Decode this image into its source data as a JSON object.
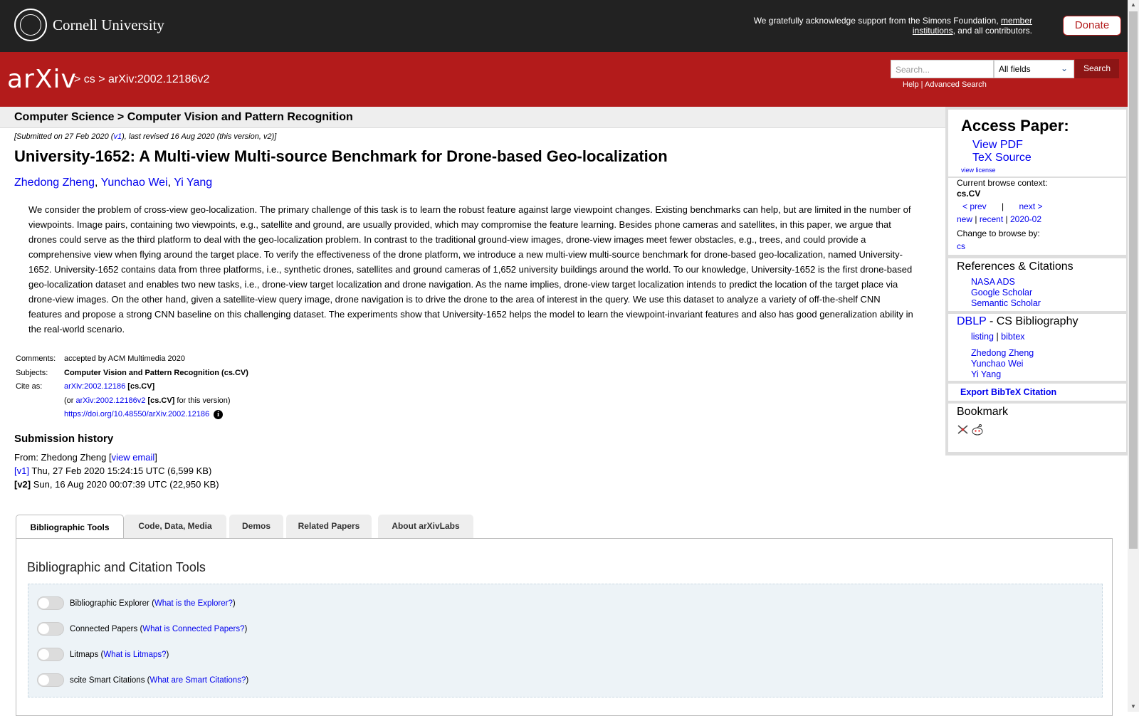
{
  "topbar": {
    "university": "Cornell University",
    "support_prefix": "We gratefully acknowledge support from the Simons Foundation, ",
    "support_link": "member institutions",
    "support_suffix": ", and all contributors.",
    "donate_label": "Donate"
  },
  "header": {
    "logo_text": "arXiv",
    "crumb_sep1": "> ",
    "crumb_cs": "cs",
    "crumb_sep2": " > ",
    "crumb_id": "arXiv:2002.12186v2",
    "search_placeholder": "Search...",
    "field_select": "All fields",
    "search_button": "Search",
    "help": "Help",
    "help_sep": " | ",
    "advanced": "Advanced Search"
  },
  "subject_bar": "Computer Science > Computer Vision and Pattern Recognition",
  "dateline": {
    "prefix": "[Submitted on 27 Feb 2020 (",
    "v1": "v1",
    "suffix": "), last revised 16 Aug 2020 (this version, v2)]"
  },
  "title": "University-1652: A Multi-view Multi-source Benchmark for Drone-based Geo-localization",
  "authors": [
    "Zhedong Zheng",
    "Yunchao Wei",
    "Yi Yang"
  ],
  "abstract": "We consider the problem of cross-view geo-localization. The primary challenge of this task is to learn the robust feature against large viewpoint changes. Existing benchmarks can help, but are limited in the number of viewpoints. Image pairs, containing two viewpoints, e.g., satellite and ground, are usually provided, which may compromise the feature learning. Besides phone cameras and satellites, in this paper, we argue that drones could serve as the third platform to deal with the geo-localization problem. In contrast to the traditional ground-view images, drone-view images meet fewer obstacles, e.g., trees, and could provide a comprehensive view when flying around the target place. To verify the effectiveness of the drone platform, we introduce a new multi-view multi-source benchmark for drone-based geo-localization, named University-1652. University-1652 contains data from three platforms, i.e., synthetic drones, satellites and ground cameras of 1,652 university buildings around the world. To our knowledge, University-1652 is the first drone-based geo-localization dataset and enables two new tasks, i.e., drone-view target localization and drone navigation. As the name implies, drone-view target localization intends to predict the location of the target place via drone-view images. On the other hand, given a satellite-view query image, drone navigation is to drive the drone to the area of interest in the query. We use this dataset to analyze a variety of off-the-shelf CNN features and propose a strong CNN baseline on this challenging dataset. The experiments show that University-1652 helps the model to learn the viewpoint-invariant features and also has good generalization ability in the real-world scenario.",
  "meta": {
    "comments_label": "Comments:",
    "comments": "accepted by ACM Multimedia 2020",
    "subjects_label": "Subjects:",
    "subjects": "Computer Vision and Pattern Recognition (cs.CV)",
    "cite_label": "Cite as:",
    "cite_id": "arXiv:2002.12186",
    "cite_cat": " [cs.CV]",
    "cite2_prefix": "(or ",
    "cite2_id": "arXiv:2002.12186v2",
    "cite2_cat": " [cs.CV]",
    "cite2_suffix": " for this version)",
    "doi": "https://doi.org/10.48550/arXiv.2002.12186",
    "info_glyph": "i"
  },
  "history": {
    "heading": "Submission history",
    "from_prefix": "From: Zhedong Zheng [",
    "view_email": "view email",
    "from_suffix": "]",
    "v1_label": "[v1]",
    "v1_text": " Thu, 27 Feb 2020 15:24:15 UTC (6,599 KB)",
    "v2_label": "[v2]",
    "v2_text": " Sun, 16 Aug 2020 00:07:39 UTC (22,950 KB)"
  },
  "sidebar": {
    "access_heading": "Access Paper:",
    "view_pdf": "View PDF",
    "tex_source": "TeX Source",
    "view_license": "view license",
    "context_label": "Current browse context:",
    "context": "cs.CV",
    "prev": "< prev",
    "sep": "|",
    "next": "next >",
    "new": "new",
    "recent": "recent",
    "date": "2020-02",
    "pipe": " | ",
    "change_label": "Change to browse by:",
    "cs": "cs",
    "refs_heading": "References & Citations",
    "nasa": "NASA ADS",
    "google": "Google Scholar",
    "semantic": "Semantic Scholar",
    "dblp": "DBLP",
    "dblp_suffix": " - CS Bibliography",
    "listing": "listing",
    "bibtex": "bibtex",
    "dblp_authors": [
      "Zhedong Zheng",
      "Yunchao Wei",
      "Yi Yang"
    ],
    "export": "Export BibTeX Citation",
    "bookmark": "Bookmark"
  },
  "tabs": [
    "Bibliographic Tools",
    "Code, Data, Media",
    "Demos",
    "Related Papers",
    "About arXivLabs"
  ],
  "panel": {
    "heading": "Bibliographic and Citation Tools",
    "tools": [
      {
        "name": "Bibliographic Explorer",
        "link": "What is the Explorer?"
      },
      {
        "name": "Connected Papers",
        "link": "What is Connected Papers?"
      },
      {
        "name": "Litmaps",
        "link": "What is Litmaps?"
      },
      {
        "name": "scite Smart Citations",
        "link": "What are Smart Citations?"
      }
    ]
  },
  "colors": {
    "arxiv_red": "#b31b1b",
    "top_bar": "#222222",
    "link": "#0000ee"
  }
}
